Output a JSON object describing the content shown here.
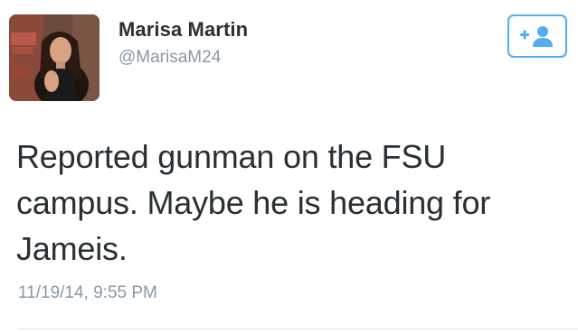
{
  "author": {
    "display_name": "Marisa Martin",
    "handle": "@MarisaM24"
  },
  "follow_button": {
    "icon": "add-user-icon",
    "glyph": "+"
  },
  "tweet": {
    "text": "Reported gunman on the FSU campus. Maybe he is heading for Jameis.",
    "timestamp": "11/19/14, 9:55 PM"
  },
  "colors": {
    "accent": "#55acee",
    "text": "#292f33",
    "muted": "#8899a6",
    "divider": "#e1e8ed"
  }
}
